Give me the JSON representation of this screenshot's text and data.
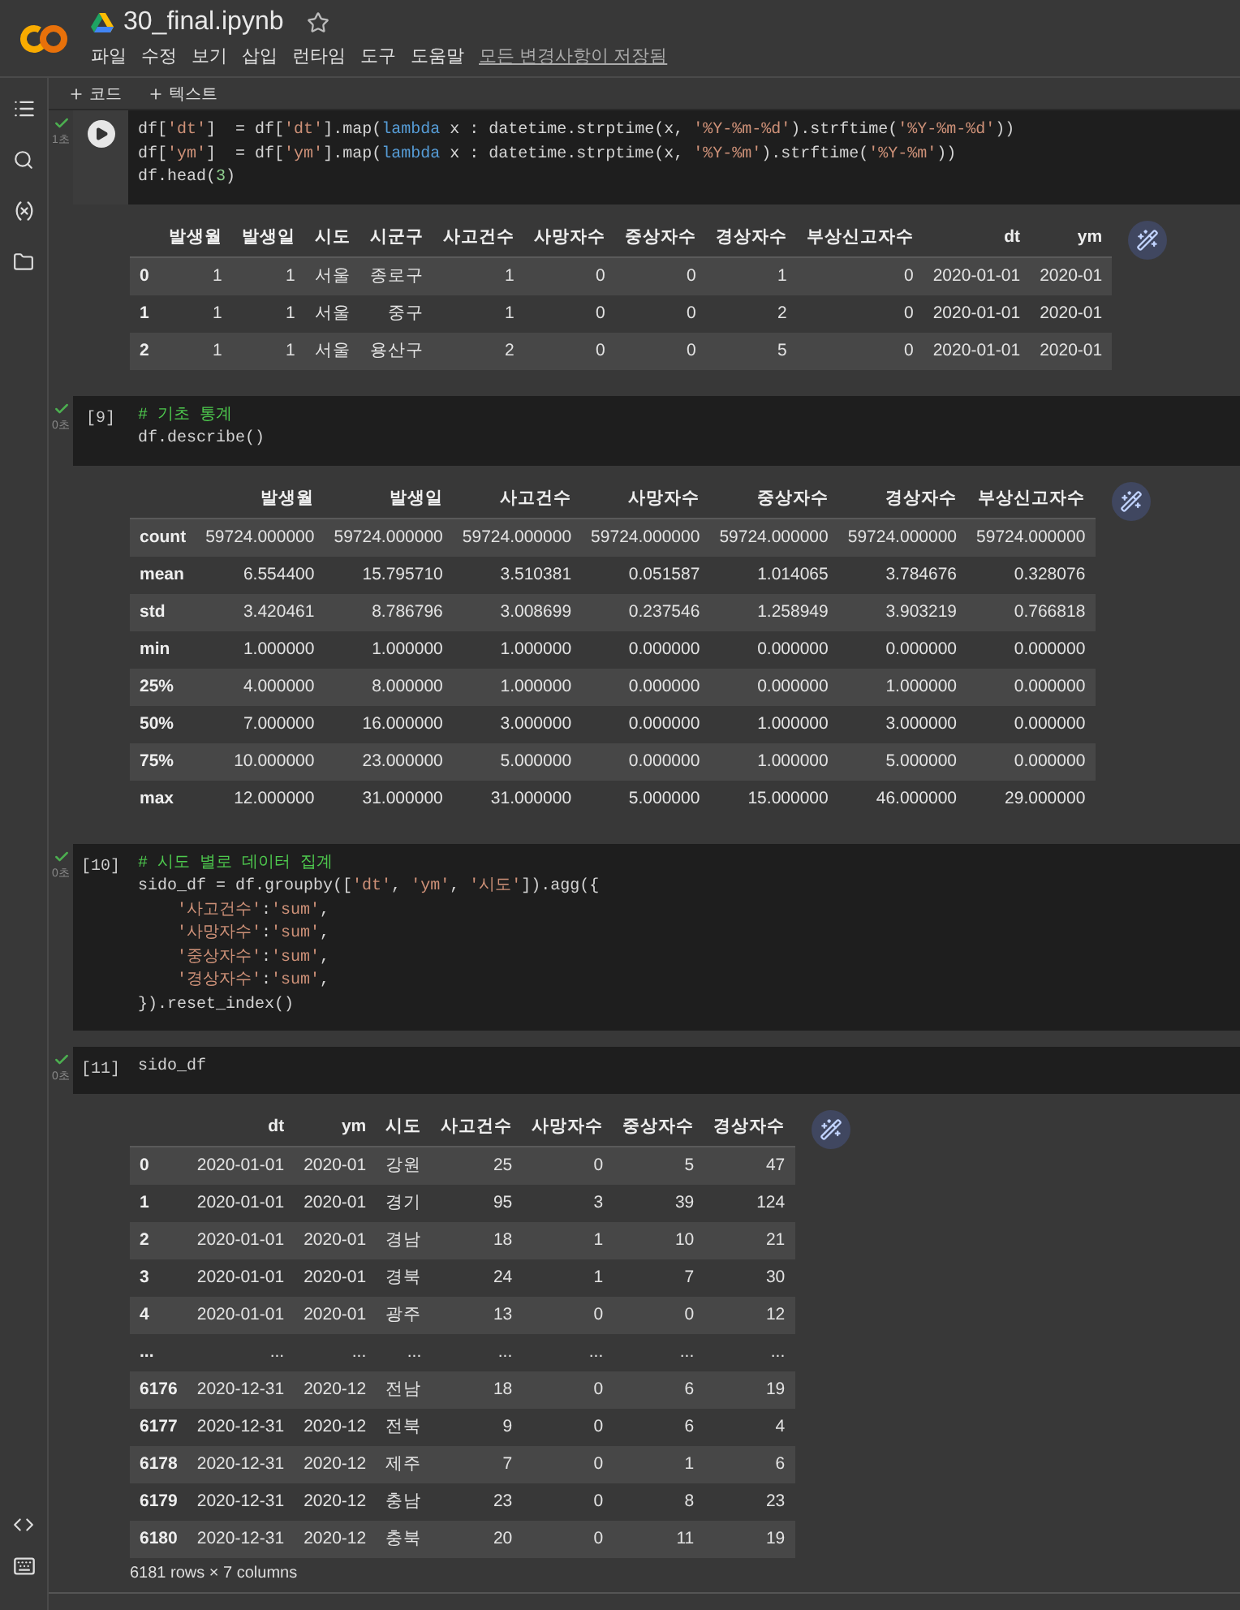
{
  "app": {
    "file_name": "30_final.ipynb",
    "starred": false,
    "menu": [
      "파일",
      "수정",
      "보기",
      "삽입",
      "런타임",
      "도구",
      "도움말"
    ],
    "save_status": "모든 변경사항이 저장됨"
  },
  "toolbar": [
    {
      "label": "코드"
    },
    {
      "label": "텍스트"
    }
  ],
  "cells": [
    {
      "focused": true,
      "prompt": {
        "kind": "run"
      },
      "status": {
        "done": true,
        "time": "1초"
      },
      "code": [
        [
          {
            "kind": "p",
            "text": "df["
          },
          {
            "kind": "s",
            "text": "'dt'"
          },
          {
            "kind": "p",
            "text": "]  = df["
          },
          {
            "kind": "s",
            "text": "'dt'"
          },
          {
            "kind": "p",
            "text": "].map("
          },
          {
            "kind": "k",
            "text": "lambda"
          },
          {
            "kind": "p",
            "text": " x : datetime.strptime(x, "
          },
          {
            "kind": "s",
            "text": "'%Y-%m-%d'"
          },
          {
            "kind": "p",
            "text": ").strftime("
          },
          {
            "kind": "s",
            "text": "'%Y-%m-%d'"
          },
          {
            "kind": "p",
            "text": "))"
          }
        ],
        [
          {
            "kind": "p",
            "text": "df["
          },
          {
            "kind": "s",
            "text": "'ym'"
          },
          {
            "kind": "p",
            "text": "]  = df["
          },
          {
            "kind": "s",
            "text": "'ym'"
          },
          {
            "kind": "p",
            "text": "].map("
          },
          {
            "kind": "k",
            "text": "lambda"
          },
          {
            "kind": "p",
            "text": " x : datetime.strptime(x, "
          },
          {
            "kind": "s",
            "text": "'%Y-%m'"
          },
          {
            "kind": "p",
            "text": ").strftime("
          },
          {
            "kind": "s",
            "text": "'%Y-%m'"
          },
          {
            "kind": "p",
            "text": "))"
          }
        ],
        [
          {
            "kind": "p",
            "text": "df.head("
          },
          {
            "kind": "n",
            "text": "3"
          },
          {
            "kind": "p",
            "text": ")"
          }
        ]
      ],
      "output": {
        "columns": [
          "발생월",
          "발생일",
          "시도",
          "시군구",
          "사고건수",
          "사망자수",
          "중상자수",
          "경상자수",
          "부상신고자수",
          "dt",
          "ym"
        ],
        "rows": [
          {
            "index": "0",
            "cells": [
              "1",
              "1",
              "서울",
              "종로구",
              "1",
              "0",
              "0",
              "1",
              "0",
              "2020-01-01",
              "2020-01"
            ]
          },
          {
            "index": "1",
            "cells": [
              "1",
              "1",
              "서울",
              "중구",
              "1",
              "0",
              "0",
              "2",
              "0",
              "2020-01-01",
              "2020-01"
            ]
          },
          {
            "index": "2",
            "cells": [
              "1",
              "1",
              "서울",
              "용산구",
              "2",
              "0",
              "0",
              "5",
              "0",
              "2020-01-01",
              "2020-01"
            ]
          }
        ]
      }
    },
    {
      "focused": false,
      "prompt": {
        "kind": "count",
        "text": "[9]"
      },
      "status": {
        "done": true,
        "time": "0초"
      },
      "code": [
        [
          {
            "kind": "c",
            "text": "# 기초 통계"
          }
        ],
        [
          {
            "kind": "p",
            "text": "df.describe()"
          }
        ]
      ],
      "output": {
        "columns": [
          "발생월",
          "발생일",
          "사고건수",
          "사망자수",
          "중상자수",
          "경상자수",
          "부상신고자수"
        ],
        "rows": [
          {
            "index": "count",
            "cells": [
              "59724.000000",
              "59724.000000",
              "59724.000000",
              "59724.000000",
              "59724.000000",
              "59724.000000",
              "59724.000000"
            ]
          },
          {
            "index": "mean",
            "cells": [
              "6.554400",
              "15.795710",
              "3.510381",
              "0.051587",
              "1.014065",
              "3.784676",
              "0.328076"
            ]
          },
          {
            "index": "std",
            "cells": [
              "3.420461",
              "8.786796",
              "3.008699",
              "0.237546",
              "1.258949",
              "3.903219",
              "0.766818"
            ]
          },
          {
            "index": "min",
            "cells": [
              "1.000000",
              "1.000000",
              "1.000000",
              "0.000000",
              "0.000000",
              "0.000000",
              "0.000000"
            ]
          },
          {
            "index": "25%",
            "cells": [
              "4.000000",
              "8.000000",
              "1.000000",
              "0.000000",
              "0.000000",
              "1.000000",
              "0.000000"
            ]
          },
          {
            "index": "50%",
            "cells": [
              "7.000000",
              "16.000000",
              "3.000000",
              "0.000000",
              "1.000000",
              "3.000000",
              "0.000000"
            ]
          },
          {
            "index": "75%",
            "cells": [
              "10.000000",
              "23.000000",
              "5.000000",
              "0.000000",
              "1.000000",
              "5.000000",
              "0.000000"
            ]
          },
          {
            "index": "max",
            "cells": [
              "12.000000",
              "31.000000",
              "31.000000",
              "5.000000",
              "15.000000",
              "46.000000",
              "29.000000"
            ]
          }
        ]
      }
    },
    {
      "focused": false,
      "prompt": {
        "kind": "count",
        "text": "[10]"
      },
      "status": {
        "done": true,
        "time": "0초"
      },
      "code": [
        [
          {
            "kind": "c",
            "text": "# 시도 별로 데이터 집계"
          }
        ],
        [
          {
            "kind": "p",
            "text": "sido_df = df.groupby(["
          },
          {
            "kind": "s",
            "text": "'dt'"
          },
          {
            "kind": "p",
            "text": ", "
          },
          {
            "kind": "s",
            "text": "'ym'"
          },
          {
            "kind": "p",
            "text": ", "
          },
          {
            "kind": "s",
            "text": "'시도'"
          },
          {
            "kind": "p",
            "text": "]).agg({"
          }
        ],
        [
          {
            "kind": "s",
            "text": "    '사고건수'"
          },
          {
            "kind": "p",
            "text": ":"
          },
          {
            "kind": "s",
            "text": "'sum'"
          },
          {
            "kind": "p",
            "text": ","
          }
        ],
        [
          {
            "kind": "s",
            "text": "    '사망자수'"
          },
          {
            "kind": "p",
            "text": ":"
          },
          {
            "kind": "s",
            "text": "'sum'"
          },
          {
            "kind": "p",
            "text": ","
          }
        ],
        [
          {
            "kind": "s",
            "text": "    '중상자수'"
          },
          {
            "kind": "p",
            "text": ":"
          },
          {
            "kind": "s",
            "text": "'sum'"
          },
          {
            "kind": "p",
            "text": ","
          }
        ],
        [
          {
            "kind": "s",
            "text": "    '경상자수'"
          },
          {
            "kind": "p",
            "text": ":"
          },
          {
            "kind": "s",
            "text": "'sum'"
          },
          {
            "kind": "p",
            "text": ","
          }
        ],
        [
          {
            "kind": "p",
            "text": "}).reset_index()"
          }
        ]
      ]
    },
    {
      "focused": false,
      "prompt": {
        "kind": "count",
        "text": "[11]"
      },
      "status": {
        "done": true,
        "time": "0초"
      },
      "code": [
        [
          {
            "kind": "p",
            "text": "sido_df"
          }
        ]
      ],
      "output": {
        "columns": [
          "dt",
          "ym",
          "시도",
          "사고건수",
          "사망자수",
          "중상자수",
          "경상자수"
        ],
        "rows": [
          {
            "index": "0",
            "cells": [
              "2020-01-01",
              "2020-01",
              "강원",
              "25",
              "0",
              "5",
              "47"
            ]
          },
          {
            "index": "1",
            "cells": [
              "2020-01-01",
              "2020-01",
              "경기",
              "95",
              "3",
              "39",
              "124"
            ]
          },
          {
            "index": "2",
            "cells": [
              "2020-01-01",
              "2020-01",
              "경남",
              "18",
              "1",
              "10",
              "21"
            ]
          },
          {
            "index": "3",
            "cells": [
              "2020-01-01",
              "2020-01",
              "경북",
              "24",
              "1",
              "7",
              "30"
            ]
          },
          {
            "index": "4",
            "cells": [
              "2020-01-01",
              "2020-01",
              "광주",
              "13",
              "0",
              "0",
              "12"
            ]
          },
          {
            "index": "...",
            "cells": [
              "...",
              "...",
              "...",
              "...",
              "...",
              "...",
              "..."
            ]
          },
          {
            "index": "6176",
            "cells": [
              "2020-12-31",
              "2020-12",
              "전남",
              "18",
              "0",
              "6",
              "19"
            ]
          },
          {
            "index": "6177",
            "cells": [
              "2020-12-31",
              "2020-12",
              "전북",
              "9",
              "0",
              "6",
              "4"
            ]
          },
          {
            "index": "6178",
            "cells": [
              "2020-12-31",
              "2020-12",
              "제주",
              "7",
              "0",
              "1",
              "6"
            ]
          },
          {
            "index": "6179",
            "cells": [
              "2020-12-31",
              "2020-12",
              "충남",
              "23",
              "0",
              "8",
              "23"
            ]
          },
          {
            "index": "6180",
            "cells": [
              "2020-12-31",
              "2020-12",
              "충북",
              "20",
              "0",
              "11",
              "19"
            ]
          }
        ],
        "footer": "6181 rows × 7 columns"
      }
    }
  ]
}
